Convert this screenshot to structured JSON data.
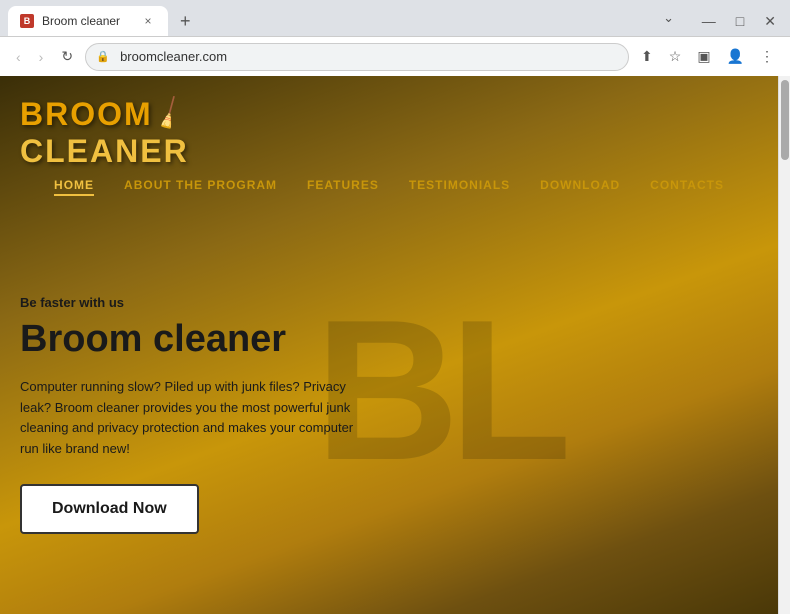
{
  "browser": {
    "tab_favicon": "B",
    "tab_title": "Broom cleaner",
    "tab_close": "×",
    "new_tab": "+",
    "win_minimize": "—",
    "win_maximize": "□",
    "win_close": "✕",
    "win_collapse": "⌄",
    "address": "broomcleaner.com",
    "lock_icon": "🔒",
    "toolbar_back": "‹",
    "toolbar_forward": "›",
    "toolbar_refresh": "↻",
    "toolbar_share": "⬆",
    "toolbar_star": "☆",
    "toolbar_tab_view": "▣",
    "toolbar_user": "👤",
    "toolbar_menu": "⋮"
  },
  "website": {
    "logo_broom": "BROOM",
    "logo_cleaner": "CLEANER",
    "logo_icon": "🧹",
    "watermark": "BL",
    "nav_items": [
      {
        "label": "HOME",
        "active": true
      },
      {
        "label": "ABOUT THE PROGRAM",
        "active": false
      },
      {
        "label": "FEATURES",
        "active": false
      },
      {
        "label": "TESTIMONIALS",
        "active": false
      },
      {
        "label": "DOWNLOAD",
        "active": false
      },
      {
        "label": "CONTACTS",
        "active": false
      }
    ],
    "hero_tagline": "Be faster with us",
    "hero_title": "Broom cleaner",
    "hero_desc": "Computer running slow? Piled up with junk files? Privacy leak? Broom cleaner provides you the most powerful junk cleaning and privacy protection and makes your computer run like brand new!",
    "download_btn": "Download Now"
  }
}
